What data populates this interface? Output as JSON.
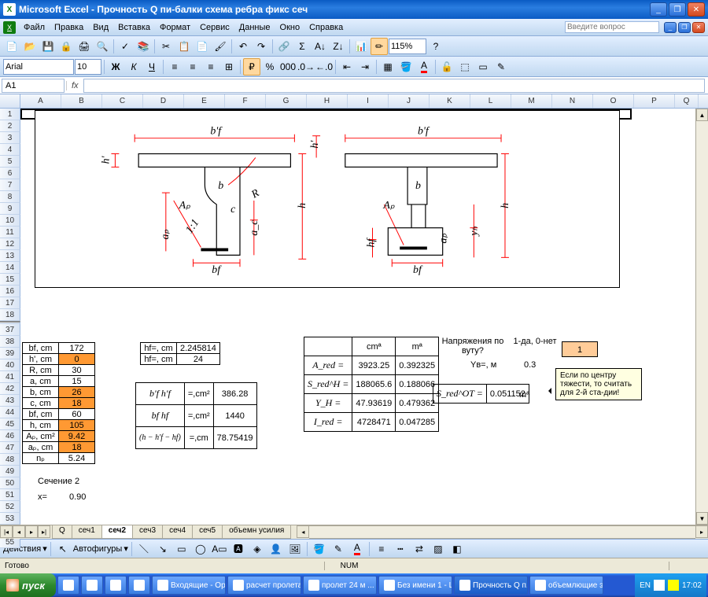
{
  "app": {
    "title": "Microsoft Excel - Прочность Q пи-балки схема ребра фикс сеч",
    "icon_label": "X"
  },
  "menu": [
    "Файл",
    "Правка",
    "Вид",
    "Вставка",
    "Формат",
    "Сервис",
    "Данные",
    "Окно",
    "Справка"
  ],
  "ask_placeholder": "Введите вопрос",
  "font": {
    "name": "Arial",
    "size": "10"
  },
  "zoom": "115%",
  "namebox": "A1",
  "columns": [
    "A",
    "B",
    "C",
    "D",
    "E",
    "F",
    "G",
    "H",
    "I",
    "J",
    "K",
    "L",
    "M",
    "N",
    "O",
    "P",
    "Q"
  ],
  "row_numbers_top": [
    "1",
    "2",
    "3",
    "4",
    "5",
    "6",
    "7",
    "8",
    "9",
    "10",
    "11",
    "12",
    "13",
    "14",
    "15",
    "16",
    "17",
    "18"
  ],
  "row_numbers_bottom": [
    "37",
    "38",
    "39",
    "40",
    "41",
    "42",
    "43",
    "44",
    "45",
    "46",
    "47",
    "48",
    "49",
    "50",
    "51",
    "52",
    "53",
    "54",
    "55"
  ],
  "diagram_labels": {
    "bpf": "b'f",
    "hpf": "h'f",
    "b": "b",
    "R": "R",
    "Ap": "Aₚ",
    "c": "c",
    "ap": "aₚ",
    "a_c": "a_c",
    "one_one": "1:1",
    "bf": "bf",
    "h": "h",
    "hf": "hf",
    "yh": "yₕ"
  },
  "table1": [
    {
      "label": "bf, cm",
      "value": "172",
      "orange": false
    },
    {
      "label": "h', cm",
      "value": "0",
      "orange": true
    },
    {
      "label": "R, cm",
      "value": "30",
      "orange": false
    },
    {
      "label": "a, cm",
      "value": "15",
      "orange": false
    },
    {
      "label": "b, cm",
      "value": "26",
      "orange": true
    },
    {
      "label": "c, cm",
      "value": "18",
      "orange": true
    },
    {
      "label": "bf, cm",
      "value": "60",
      "orange": false
    },
    {
      "label": "h, cm",
      "value": "105",
      "orange": true
    },
    {
      "label": "Aₚ, cm²",
      "value": "9.42",
      "orange": true
    },
    {
      "label": "aₚ, cm",
      "value": "18",
      "orange": true
    },
    {
      "label": "nₚ",
      "value": "5.24",
      "orange": false
    }
  ],
  "section_label": "Сечение 2",
  "x_label": "x=",
  "x_value": "0.90",
  "table2": [
    {
      "label": "hf=, cm",
      "value": "2.245814"
    },
    {
      "label": "hf=, cm",
      "value": "24"
    }
  ],
  "table3": [
    {
      "formula": "b'f h'f",
      "unit": "=,cm²",
      "value": "386.28"
    },
    {
      "formula": "bf hf",
      "unit": "=,cm²",
      "value": "1440"
    },
    {
      "formula": "(h − h'f − hf)",
      "unit": "=,cm",
      "value": "78.75419"
    }
  ],
  "table4_headers": [
    "",
    "cmª",
    "mª"
  ],
  "table4": [
    {
      "sym": "A_red =",
      "a": "3923.25",
      "b": "0.392325"
    },
    {
      "sym": "S_red^H =",
      "a": "188065.6",
      "b": "0.188066"
    },
    {
      "sym": "Y_H =",
      "a": "47.93619",
      "b": "0.479362"
    },
    {
      "sym": "I_red =",
      "a": "4728471",
      "b": "0.047285"
    }
  ],
  "right_block": {
    "q1": "Напряжения по вуту?",
    "q2": "1-да, 0-нет",
    "ans": "1",
    "yb_label": "Yв=, м",
    "yb_value": "0.3",
    "s_label": "S_red^OT =",
    "s_value": "0.051152",
    "s_unit": "mª"
  },
  "comment_text": "Если по центру тяжести, то считать для 2-й ста-дии!",
  "sheet_tabs": [
    "Q",
    "сеч1",
    "сеч2",
    "сеч3",
    "сеч4",
    "сеч5",
    "объемн усилия"
  ],
  "active_tab": "сеч2",
  "drawbar": {
    "actions": "Действия",
    "autoshapes": "Автофигуры"
  },
  "status": "Готово",
  "status_num": "NUM",
  "taskbar": {
    "start": "пуск",
    "buttons": [
      "Входящие - Ор...",
      "расчет пролета",
      "пролет 24 м ...",
      "Без имени 1 - Li...",
      "Прочность Q п...",
      "объемлющие э..."
    ],
    "lang": "EN",
    "time": "17:02"
  }
}
